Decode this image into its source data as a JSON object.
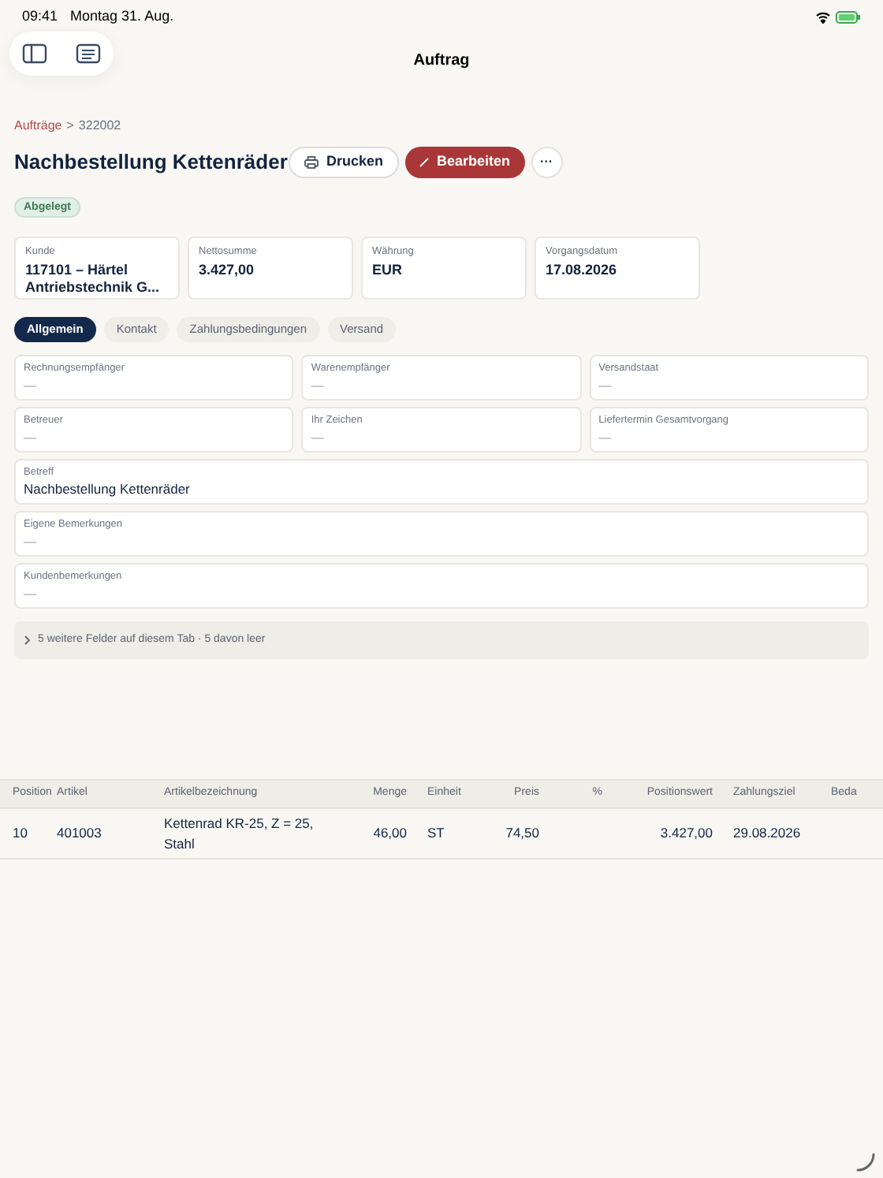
{
  "status_bar": {
    "time": "09:41",
    "date": "Montag 31. Aug."
  },
  "nav": {
    "title": "Auftrag"
  },
  "breadcrumb": {
    "parent": "Aufträge",
    "separator": ">",
    "current": "322002"
  },
  "header": {
    "title": "Nachbestellung Kettenräder",
    "status": "Abgelegt",
    "actions": [
      {
        "kind": "print",
        "label": "Drucken"
      },
      {
        "kind": "edit",
        "label": "Bearbeiten"
      },
      {
        "kind": "more",
        "label": "···"
      }
    ]
  },
  "summary": [
    {
      "label": "Kunde",
      "value": "117101 – Härtel Antriebstechnik G..."
    },
    {
      "label": "Nettosumme",
      "value": "3.427,00"
    },
    {
      "label": "Währung",
      "value": "EUR"
    },
    {
      "label": "Vorgangsdatum",
      "value": "17.08.2026"
    }
  ],
  "tabs": [
    {
      "label": "Allgemein",
      "selected": true
    },
    {
      "label": "Kontakt",
      "selected": false
    },
    {
      "label": "Zahlungsbedingungen",
      "selected": false
    },
    {
      "label": "Versand",
      "selected": false
    }
  ],
  "fields": [
    {
      "label": "Rechnungsempfänger",
      "value": "—",
      "wide": false
    },
    {
      "label": "Warenempfänger",
      "value": "—",
      "wide": false
    },
    {
      "label": "Versandstaat",
      "value": "—",
      "wide": false
    },
    {
      "label": "Betreuer",
      "value": "—",
      "wide": false
    },
    {
      "label": "Ihr Zeichen",
      "value": "—",
      "wide": false
    },
    {
      "label": "Liefertermin Gesamtvorgang",
      "value": "—",
      "wide": false
    },
    {
      "label": "Betreff",
      "value": "Nachbestellung Kettenräder",
      "wide": true
    },
    {
      "label": "Eigene Bemerkungen",
      "value": "—",
      "wide": true
    },
    {
      "label": "Kundenbemerkungen",
      "value": "—",
      "wide": true
    }
  ],
  "more_fields": {
    "expanded": false,
    "label": "5 weitere Felder auf diesem Tab · 5 davon leer"
  },
  "table": {
    "columns": [
      "Position",
      "Artikel",
      "Artikelbezeichnung",
      "Menge",
      "Einheit",
      "Preis",
      "%",
      "Positionswert",
      "Zahlungsziel",
      "Beda"
    ],
    "rows": [
      [
        "10",
        "401003",
        "Kettenrad KR-25, Z = 25, Stahl",
        "46,00",
        "ST",
        "74,50",
        "",
        "3.427,00",
        "29.08.2026",
        ""
      ]
    ]
  }
}
